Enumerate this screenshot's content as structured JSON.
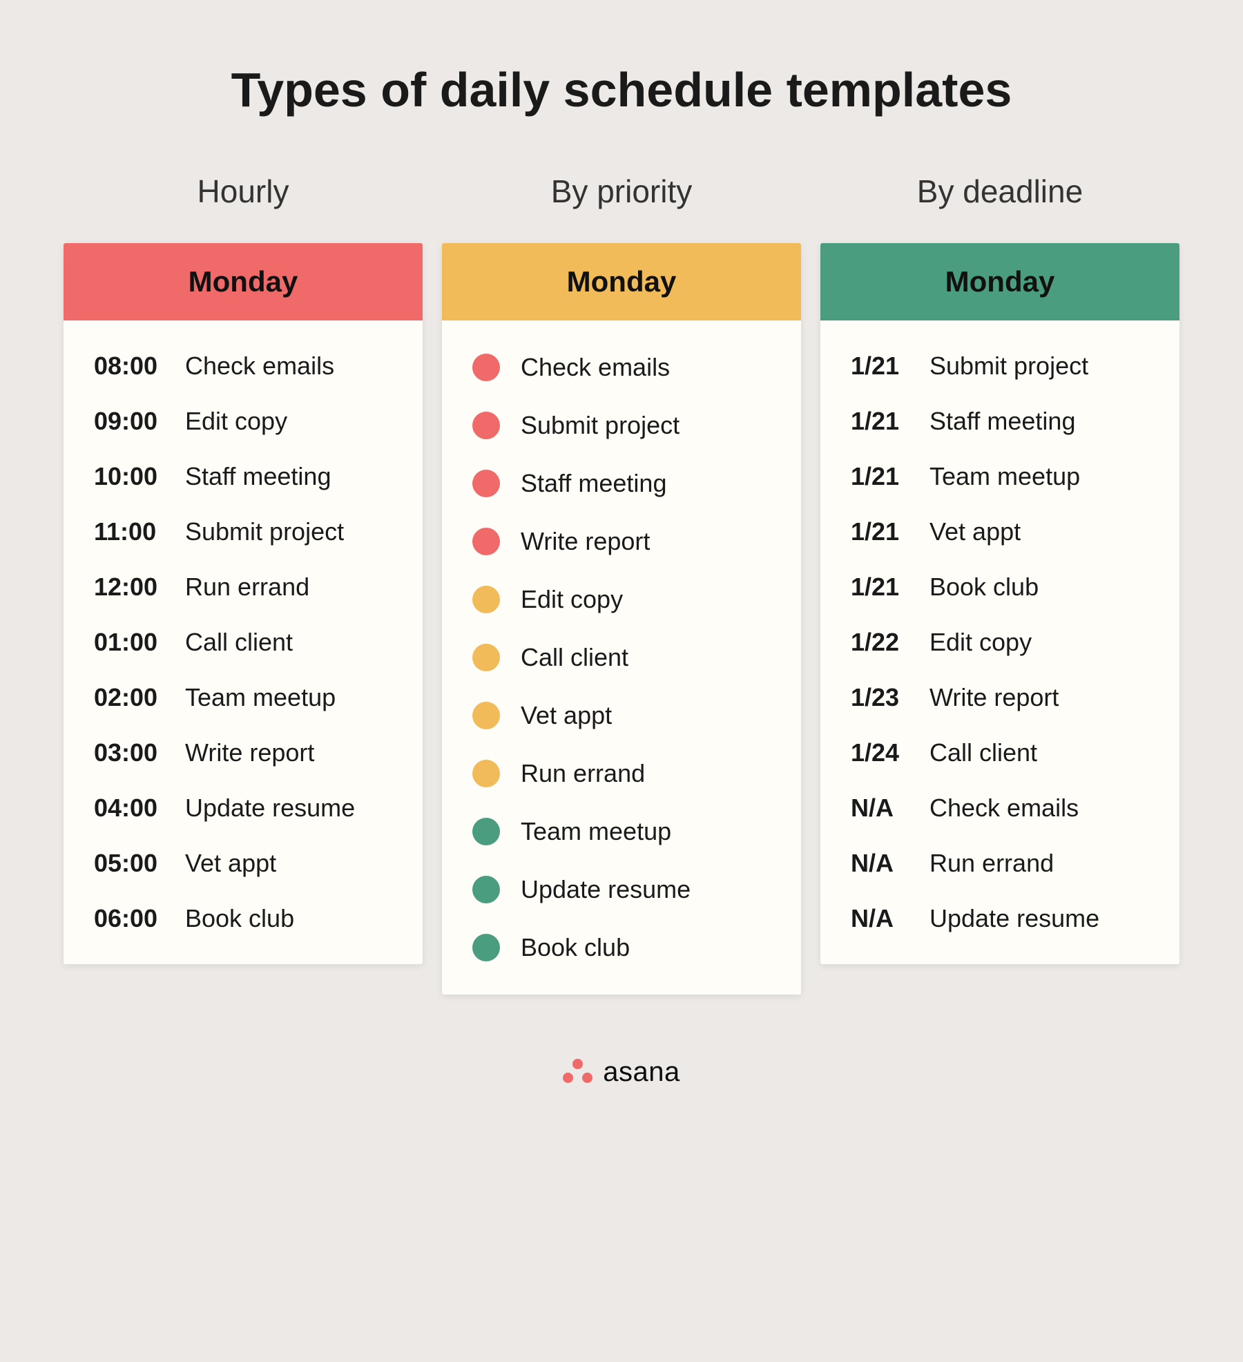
{
  "title": "Types of daily schedule templates",
  "brand": "asana",
  "colors": {
    "priority_high": "#ef6a68",
    "priority_med": "#f1bb59",
    "priority_low": "#4a9d7f"
  },
  "columns": [
    {
      "heading": "Hourly",
      "header_label": "Monday",
      "header_color": "hdr-red",
      "type": "time",
      "items": [
        {
          "left": "08:00",
          "task": "Check emails"
        },
        {
          "left": "09:00",
          "task": "Edit copy"
        },
        {
          "left": "10:00",
          "task": "Staff meeting"
        },
        {
          "left": "11:00",
          "task": "Submit project"
        },
        {
          "left": "12:00",
          "task": "Run errand"
        },
        {
          "left": "01:00",
          "task": "Call client"
        },
        {
          "left": "02:00",
          "task": "Team meetup"
        },
        {
          "left": "03:00",
          "task": "Write report"
        },
        {
          "left": "04:00",
          "task": "Update resume"
        },
        {
          "left": "05:00",
          "task": "Vet appt"
        },
        {
          "left": "06:00",
          "task": "Book club"
        }
      ]
    },
    {
      "heading": "By priority",
      "header_label": "Monday",
      "header_color": "hdr-yellow",
      "type": "priority",
      "items": [
        {
          "dot": "priority_high",
          "task": "Check emails"
        },
        {
          "dot": "priority_high",
          "task": "Submit project"
        },
        {
          "dot": "priority_high",
          "task": "Staff meeting"
        },
        {
          "dot": "priority_high",
          "task": "Write report"
        },
        {
          "dot": "priority_med",
          "task": "Edit copy"
        },
        {
          "dot": "priority_med",
          "task": "Call client"
        },
        {
          "dot": "priority_med",
          "task": "Vet appt"
        },
        {
          "dot": "priority_med",
          "task": "Run errand"
        },
        {
          "dot": "priority_low",
          "task": "Team meetup"
        },
        {
          "dot": "priority_low",
          "task": "Update resume"
        },
        {
          "dot": "priority_low",
          "task": "Book club"
        }
      ]
    },
    {
      "heading": "By deadline",
      "header_label": "Monday",
      "header_color": "hdr-green",
      "type": "date",
      "items": [
        {
          "left": "1/21",
          "task": "Submit project"
        },
        {
          "left": "1/21",
          "task": "Staff meeting"
        },
        {
          "left": "1/21",
          "task": "Team meetup"
        },
        {
          "left": "1/21",
          "task": "Vet appt"
        },
        {
          "left": "1/21",
          "task": "Book club"
        },
        {
          "left": "1/22",
          "task": "Edit copy"
        },
        {
          "left": "1/23",
          "task": "Write report"
        },
        {
          "left": "1/24",
          "task": "Call client"
        },
        {
          "left": "N/A",
          "task": "Check emails"
        },
        {
          "left": "N/A",
          "task": "Run errand"
        },
        {
          "left": "N/A",
          "task": "Update resume"
        }
      ]
    }
  ]
}
